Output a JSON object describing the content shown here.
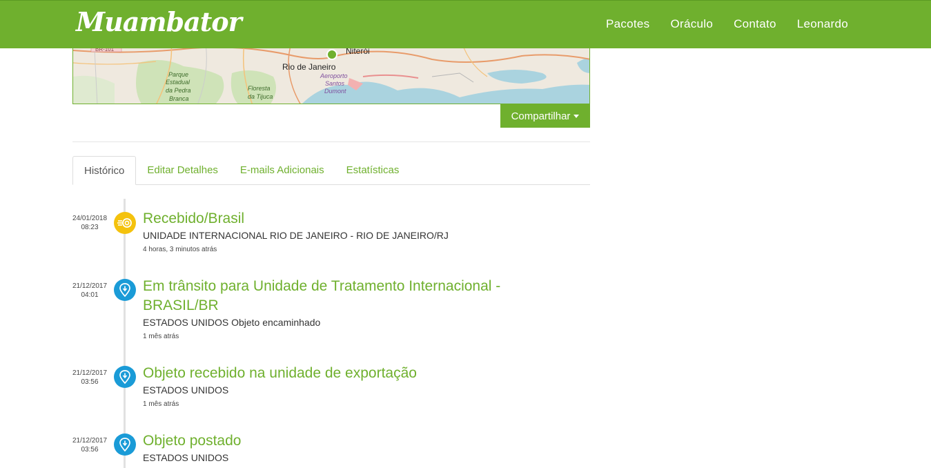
{
  "header": {
    "logo": "Muambator",
    "nav": [
      "Pacotes",
      "Oráculo",
      "Contato",
      "Leonardo"
    ]
  },
  "map": {
    "labels": {
      "niteroi": "Niterói",
      "rio": "Rio de Janeiro",
      "aeroporto1": "Aeroporto",
      "aeroporto2": "Santos",
      "aeroporto3": "Dumont",
      "parque1": "Parque",
      "parque2": "Estadual",
      "parque3": "da Pedra",
      "parque4": "Branca",
      "floresta1": "Floresta",
      "floresta2": "da Tijuca",
      "road": "BR-101"
    }
  },
  "share_label": "Compartilhar",
  "tabs": [
    "Histórico",
    "Editar Detalhes",
    "E-mails Adicionais",
    "Estatísticas"
  ],
  "events": [
    {
      "date": "24/01/2018",
      "time": "08:23",
      "icon": "received-icon",
      "title": "Recebido/Brasil",
      "desc": "UNIDADE INTERNACIONAL RIO DE JANEIRO - RIO DE JANEIRO/RJ",
      "ago": "4 horas, 3 minutos atrás"
    },
    {
      "date": "21/12/2017",
      "time": "04:01",
      "icon": "location-pin-icon",
      "title": "Em trânsito para Unidade de Tratamento Internacional - BRASIL/BR",
      "desc": "ESTADOS UNIDOS Objeto encaminhado",
      "ago": "1 mês atrás"
    },
    {
      "date": "21/12/2017",
      "time": "03:56",
      "icon": "location-pin-icon",
      "title": "Objeto recebido na unidade de exportação",
      "desc": "ESTADOS UNIDOS",
      "ago": "1 mês atrás"
    },
    {
      "date": "21/12/2017",
      "time": "03:56",
      "icon": "location-pin-icon",
      "title": "Objeto postado",
      "desc": "ESTADOS UNIDOS",
      "ago": ""
    }
  ],
  "colors": {
    "brand": "#6fb02e",
    "yellow": "#f4c20d",
    "blue": "#1a9bd7"
  }
}
